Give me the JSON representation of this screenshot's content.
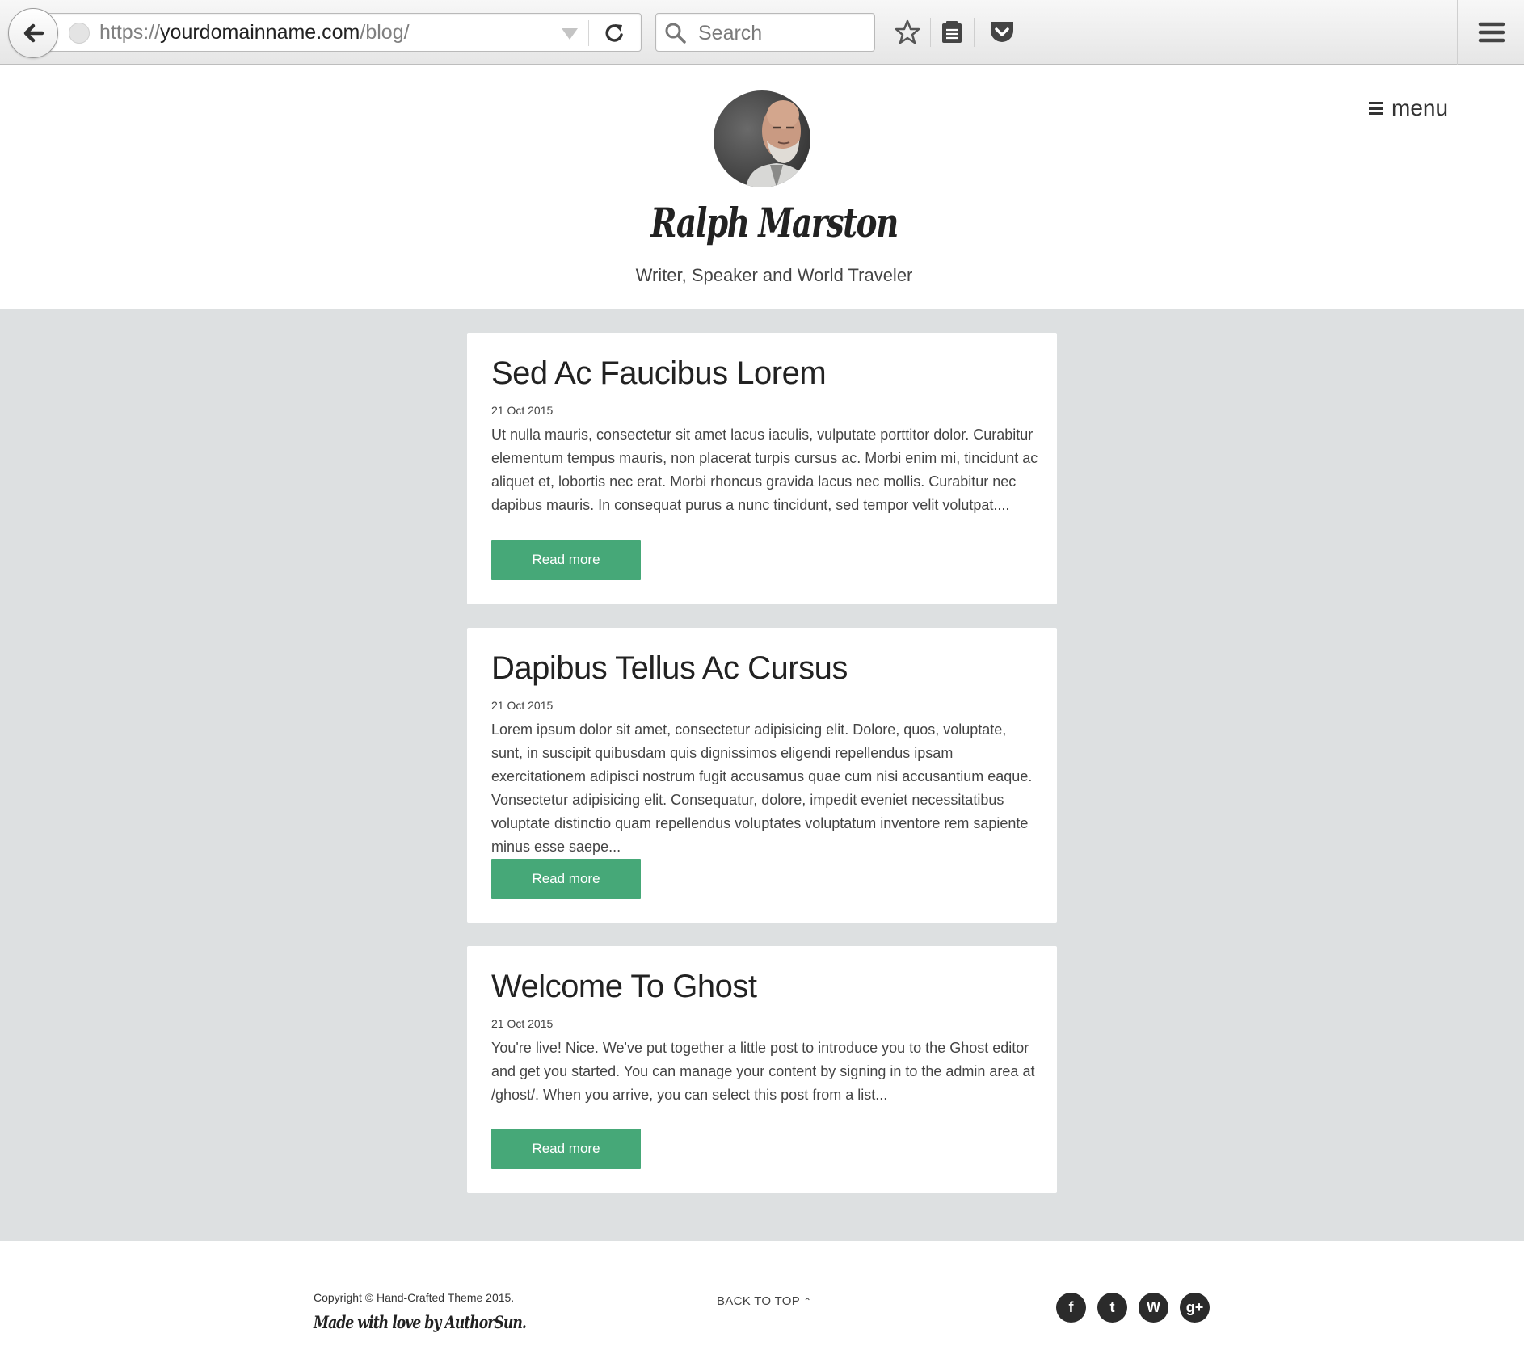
{
  "browser": {
    "url_scheme": "https://",
    "url_host": "yourdomainname.com",
    "url_path": "/blog/",
    "search_placeholder": "Search"
  },
  "header": {
    "site_name": "Ralph Marston",
    "tagline": "Writer, Speaker and World Traveler",
    "menu_label": "menu"
  },
  "posts": [
    {
      "title": "Sed Ac Faucibus Lorem",
      "date": "21 Oct 2015",
      "excerpt": "Ut nulla mauris, consectetur sit amet lacus iaculis, vulputate porttitor dolor. Curabitur elementum tempus mauris, non placerat turpis cursus ac. Morbi enim mi, tincidunt ac aliquet et, lobortis nec erat. Morbi rhoncus gravida lacus nec mollis. Curabitur nec dapibus mauris. In consequat purus a nunc tincidunt, sed tempor velit volutpat....",
      "button": "Read more"
    },
    {
      "title": "Dapibus Tellus Ac Cursus",
      "date": "21 Oct 2015",
      "excerpt": "Lorem ipsum dolor sit amet, consectetur adipisicing elit. Dolore, quos, voluptate, sunt, in suscipit quibusdam quis dignissimos eligendi repellendus ipsam exercitationem adipisci nostrum fugit accusamus quae cum nisi accusantium eaque. Vonsectetur adipisicing elit. Consequatur, dolore, impedit eveniet necessitatibus voluptate distinctio quam repellendus voluptates voluptatum inventore rem sapiente minus esse saepe...",
      "button": "Read more"
    },
    {
      "title": "Welcome To Ghost",
      "date": "21 Oct 2015",
      "excerpt": "You're live! Nice. We've put together a little post to introduce you to the Ghost editor and get you started. You can manage your content by signing in to the admin area at /ghost/. When you arrive, you can select this post from a list...",
      "button": "Read more"
    }
  ],
  "footer": {
    "copyright": "Copyright © Hand-Crafted Theme 2015.",
    "made_by": "Made with love by AuthorSun.",
    "back_to_top": "BACK TO TOP",
    "social_icons": [
      "facebook-icon",
      "twitter-icon",
      "wordpress-icon",
      "google-plus-icon"
    ],
    "social_glyphs": [
      "f",
      "t",
      "W",
      "g+"
    ]
  },
  "colors": {
    "accent": "#46a878",
    "content_background": "#dde0e1",
    "social_icon": "#2b2b2b"
  }
}
